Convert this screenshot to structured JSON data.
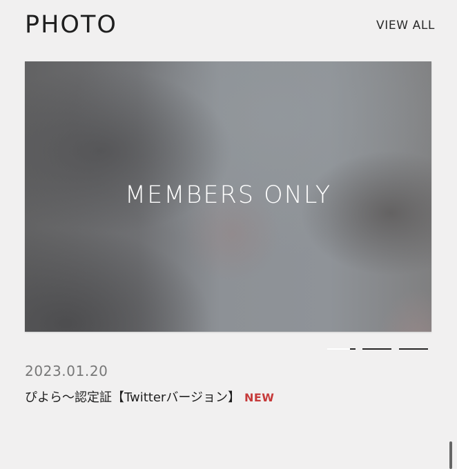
{
  "section": {
    "title": "PHOTO",
    "view_all_label": "VIEW ALL"
  },
  "photo": {
    "overlay_label": "MEMBERS ONLY",
    "current_slide": 1,
    "slide_count": 3
  },
  "post": {
    "date": "2023.01.20",
    "title": "ぴよら～認定証【Twitterバージョン】",
    "badge": "NEW"
  },
  "colors": {
    "background": "#f1f0f0",
    "text": "#1f1f1f",
    "date_text": "#777777",
    "new_badge": "#c63a3a",
    "overlay_text": "#ffffff"
  }
}
